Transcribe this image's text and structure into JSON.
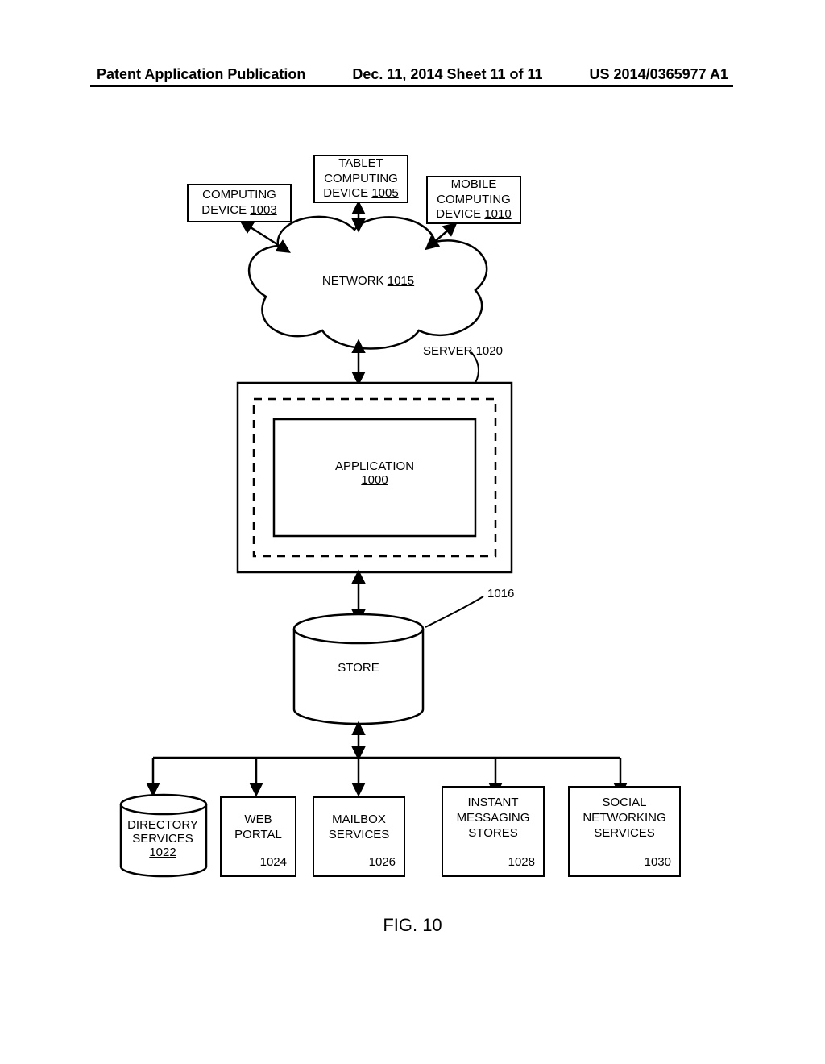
{
  "header": {
    "left": "Patent Application Publication",
    "center": "Dec. 11, 2014  Sheet 11 of 11",
    "right": "US 2014/0365977 A1"
  },
  "devices": {
    "computing": {
      "label": "COMPUTING DEVICE",
      "ref": "1003"
    },
    "tablet": {
      "label": "TABLET COMPUTING DEVICE",
      "ref": "1005"
    },
    "mobile": {
      "label": "MOBILE COMPUTING DEVICE",
      "ref": "1010"
    }
  },
  "network": {
    "label": "NETWORK",
    "ref": "1015"
  },
  "server": {
    "label": "SERVER",
    "ref": "1020"
  },
  "application": {
    "label": "APPLICATION",
    "ref": "1000"
  },
  "store": {
    "label": "STORE",
    "ref": "1016"
  },
  "services": {
    "directory": {
      "label": "DIRECTORY SERVICES",
      "ref": "1022"
    },
    "web": {
      "label": "WEB PORTAL",
      "ref": "1024"
    },
    "mailbox": {
      "label": "MAILBOX SERVICES",
      "ref": "1026"
    },
    "im": {
      "label": "INSTANT MESSAGING STORES",
      "ref": "1028"
    },
    "social": {
      "label": "SOCIAL NETWORKING SERVICES",
      "ref": "1030"
    }
  },
  "figure": "FIG. 10"
}
